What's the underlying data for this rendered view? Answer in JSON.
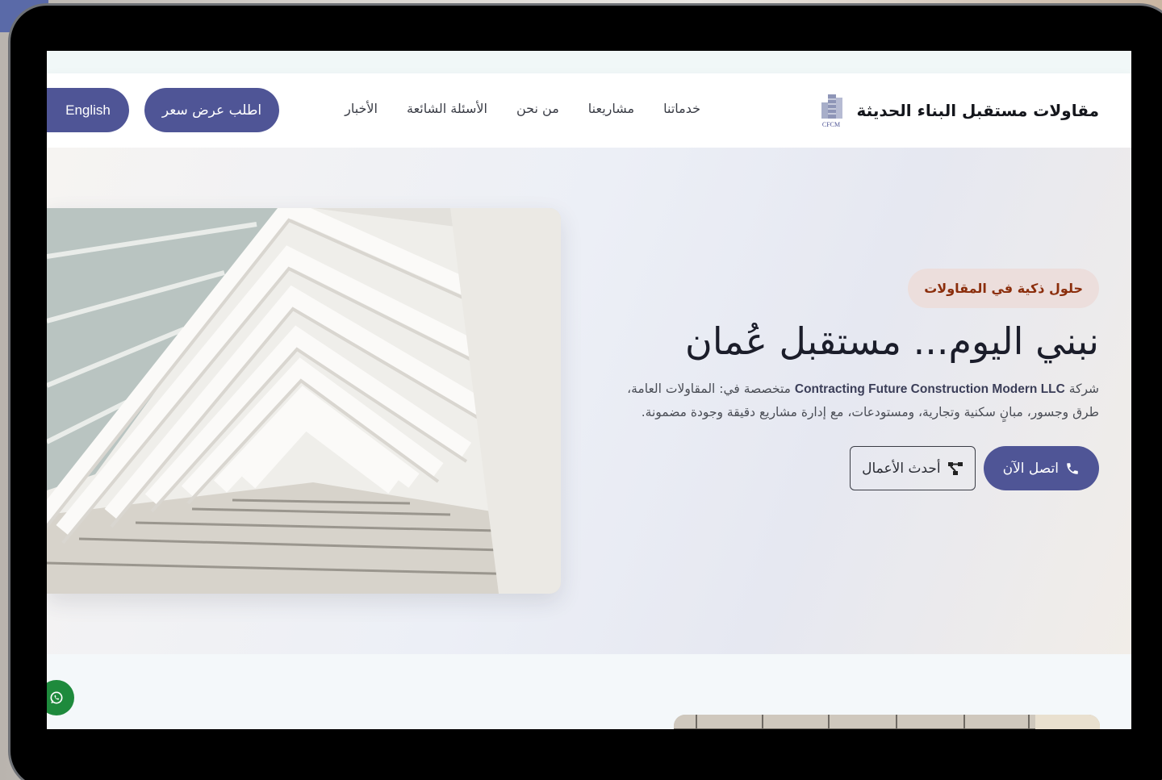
{
  "header": {
    "brand_name": "مقاولات مستقبل البناء الحديثة",
    "logo_text": "CFCM",
    "nav": [
      {
        "label": "خدماتنا"
      },
      {
        "label": "مشاريعنا"
      },
      {
        "label": "من نحن"
      },
      {
        "label": "الأسئلة الشائعة"
      },
      {
        "label": "الأخبار"
      }
    ],
    "quote_button": "اطلب عرض سعر",
    "language_button": "English"
  },
  "hero": {
    "tag": "حلول ذكية في المقاولات",
    "headline": "نبني اليوم... مستقبل عُمان",
    "desc_prefix": "شركة",
    "company_en": "Contracting Future Construction Modern LLC",
    "desc_rest": "متخصصة في: المقاولات العامة، طرق وجسور، مبانٍ سكنية وتجارية، ومستودعات، مع إدارة مشاريع دقيقة وجودة مضمونة.",
    "call_button": "اتصل الآن",
    "works_button": "أحدث الأعمال"
  },
  "colors": {
    "accent": "#4f5596",
    "tag_bg": "#ecdedc",
    "tag_text": "#8b2e0c",
    "whatsapp": "#1e8a3c"
  },
  "icons": {
    "call": "phone-icon",
    "works": "project-diagram-icon",
    "chat": "whatsapp-icon"
  }
}
